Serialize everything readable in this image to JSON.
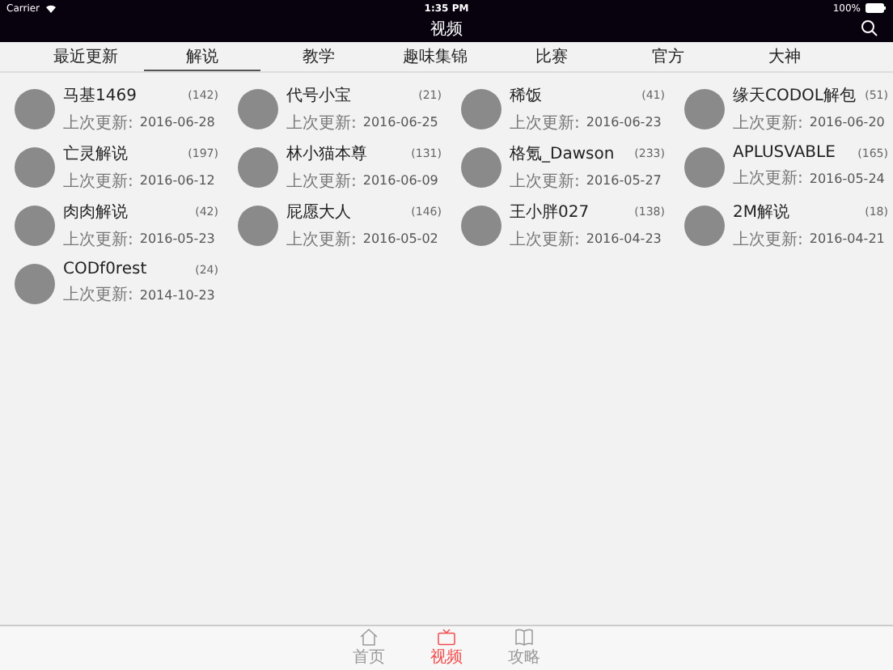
{
  "status_bar": {
    "carrier": "Carrier",
    "time": "1:35 PM",
    "battery": "100%"
  },
  "nav_bar": {
    "title": "视频"
  },
  "tabs": [
    {
      "label": "最近更新",
      "selected": false
    },
    {
      "label": "解说",
      "selected": true
    },
    {
      "label": "教学",
      "selected": false
    },
    {
      "label": "趣味集锦",
      "selected": false
    },
    {
      "label": "比赛",
      "selected": false
    },
    {
      "label": "官方",
      "selected": false
    },
    {
      "label": "大神",
      "selected": false
    }
  ],
  "channels": [
    {
      "name": "马基1469",
      "count": "(142)",
      "updated_label": "上次更新:",
      "date": "2016-06-28"
    },
    {
      "name": "代号小宝",
      "count": "(21)",
      "updated_label": "上次更新:",
      "date": "2016-06-25"
    },
    {
      "name": "稀饭",
      "count": "(41)",
      "updated_label": "上次更新:",
      "date": "2016-06-23"
    },
    {
      "name": "缘天CODOL解包",
      "count": "(51)",
      "updated_label": "上次更新:",
      "date": "2016-06-20"
    },
    {
      "name": "亡灵解说",
      "count": "(197)",
      "updated_label": "上次更新:",
      "date": "2016-06-12"
    },
    {
      "name": "林小猫本尊",
      "count": "(131)",
      "updated_label": "上次更新:",
      "date": "2016-06-09"
    },
    {
      "name": "格氪_Dawson",
      "count": "(233)",
      "updated_label": "上次更新:",
      "date": "2016-05-27"
    },
    {
      "name": "APLUSVABLE",
      "count": "(165)",
      "updated_label": "上次更新:",
      "date": "2016-05-24"
    },
    {
      "name": "肉肉解说",
      "count": "(42)",
      "updated_label": "上次更新:",
      "date": "2016-05-23"
    },
    {
      "name": "屁愿大人",
      "count": "(146)",
      "updated_label": "上次更新:",
      "date": "2016-05-02"
    },
    {
      "name": "王小胖027",
      "count": "(138)",
      "updated_label": "上次更新:",
      "date": "2016-04-23"
    },
    {
      "name": "2M解说",
      "count": "(18)",
      "updated_label": "上次更新:",
      "date": "2016-04-21"
    },
    {
      "name": "CODf0rest",
      "count": "(24)",
      "updated_label": "上次更新:",
      "date": "2014-10-23"
    }
  ],
  "tab_bar": [
    {
      "kind": "home",
      "label": "首页",
      "selected": false
    },
    {
      "kind": "tv",
      "label": "视频",
      "selected": true
    },
    {
      "kind": "book",
      "label": "攻略",
      "selected": false
    }
  ]
}
